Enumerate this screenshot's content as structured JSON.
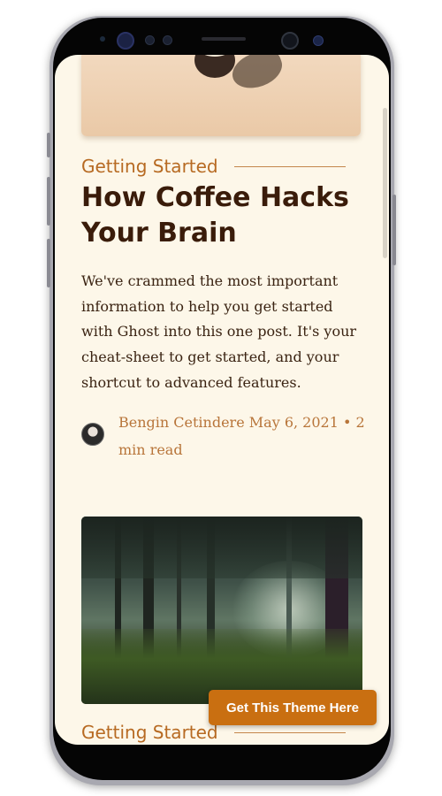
{
  "post_1": {
    "category": "Getting Started",
    "title": "How Coffee Hacks Your Brain",
    "excerpt": "We've crammed the most important information to help you get started with Ghost into this one post. It's your cheat-sheet to get started, and your shortcut to advanced features.",
    "author": "Bengin Cetindere",
    "date": "May 6, 2021",
    "separator": "•",
    "read_time": "2 min read"
  },
  "post_2": {
    "category": "Getting Started"
  },
  "cta": {
    "label": "Get This Theme Here"
  },
  "colors": {
    "background": "#fdf7e9",
    "accent": "#c96f11",
    "title": "#3a1c0a",
    "meta": "#b8753a"
  }
}
